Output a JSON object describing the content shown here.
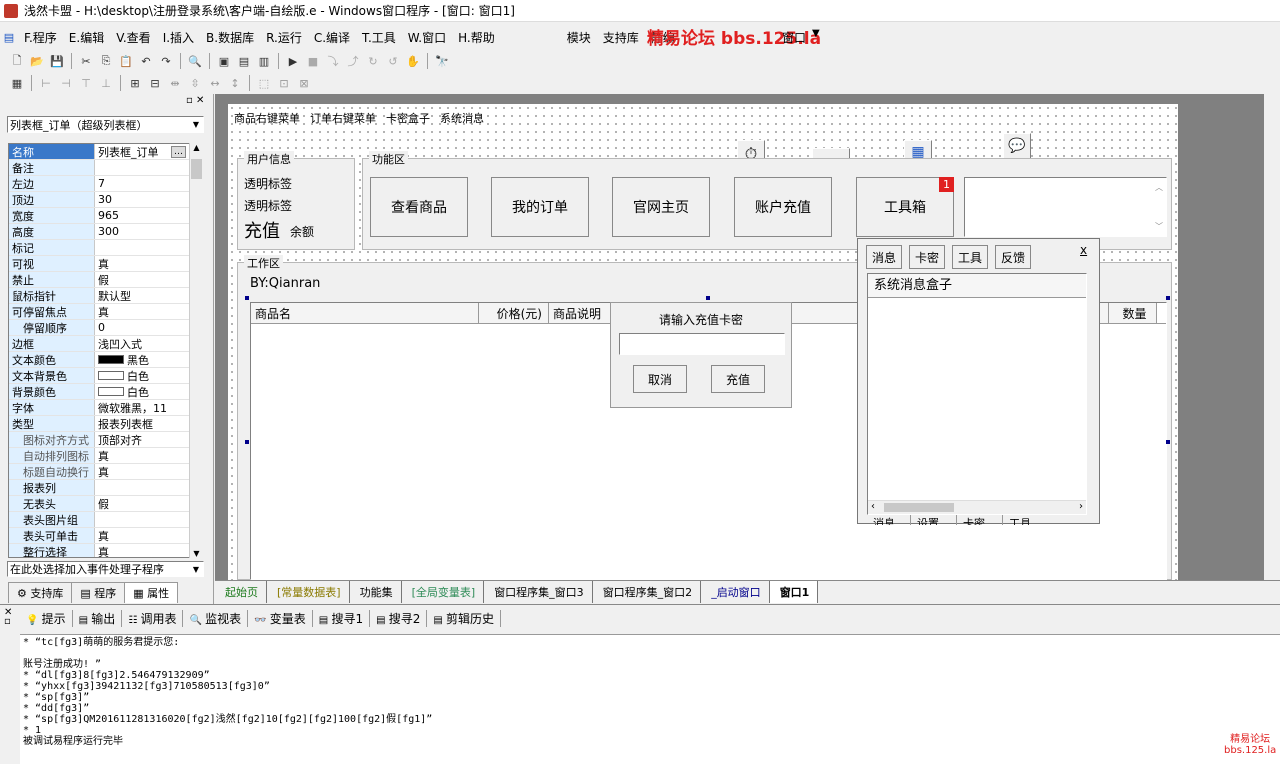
{
  "window": {
    "title": "浅然卡盟 - H:\\desktop\\注册登录系统\\客户端-自绘版.e - Windows窗口程序 - [窗口: 窗口1]"
  },
  "watermark": {
    "text": "精易论坛 bbs.125.la",
    "corner_line1": "精易论坛",
    "corner_line2": "bbs.125.la"
  },
  "menu": {
    "items": [
      "F.程序",
      "E.编辑",
      "V.查看",
      "I.插入",
      "B.数据库",
      "R.运行",
      "C.编译",
      "T.工具",
      "W.窗口",
      "H.帮助"
    ],
    "right_items": [
      "模块",
      "支持库",
      "静编",
      "",
      "",
      "",
      "",
      "窗口"
    ]
  },
  "left_panel": {
    "combo": "列表框_订单（超级列表框）",
    "props": [
      {
        "name": "名称",
        "value": "列表框_订单",
        "style": "blue"
      },
      {
        "name": "备注",
        "value": ""
      },
      {
        "name": "左边",
        "value": "7"
      },
      {
        "name": "顶边",
        "value": "30"
      },
      {
        "name": "宽度",
        "value": "965"
      },
      {
        "name": "高度",
        "value": "300"
      },
      {
        "name": "标记",
        "value": ""
      },
      {
        "name": "可视",
        "value": "真"
      },
      {
        "name": "禁止",
        "value": "假"
      },
      {
        "name": "鼠标指针",
        "value": "默认型"
      },
      {
        "name": "可停留焦点",
        "value": "真"
      },
      {
        "name": "停留顺序",
        "value": "0",
        "indent": true
      },
      {
        "name": "边框",
        "value": "浅凹入式"
      },
      {
        "name": "文本颜色",
        "value": "黑色",
        "swatch": "#000000"
      },
      {
        "name": "文本背景色",
        "value": "白色",
        "swatch": "#ffffff"
      },
      {
        "name": "背景颜色",
        "value": "白色",
        "swatch": "#ffffff"
      },
      {
        "name": "字体",
        "value": "微软雅黑，11"
      },
      {
        "name": "类型",
        "value": "报表列表框"
      },
      {
        "name": "图标对齐方式",
        "value": "顶部对齐",
        "indent": true,
        "gray": true
      },
      {
        "name": "自动排列图标",
        "value": "真",
        "indent": true,
        "gray": true
      },
      {
        "name": "标题自动换行",
        "value": "真",
        "indent": true,
        "gray": true
      },
      {
        "name": "报表列",
        "value": "",
        "indent": true
      },
      {
        "name": "无表头",
        "value": "假",
        "indent": true
      },
      {
        "name": "表头图片组",
        "value": "",
        "indent": true
      },
      {
        "name": "表头可单击",
        "value": "真",
        "indent": true
      },
      {
        "name": "整行选择",
        "value": "真",
        "indent": true
      }
    ],
    "event_combo": "在此处选择加入事件处理子程序",
    "bottom_tabs": [
      "支持库",
      "程序",
      "属性"
    ]
  },
  "designer": {
    "menu": [
      "商品右键菜单",
      "订单右键菜单",
      "卡密盒子",
      "系统消息"
    ],
    "user_group": {
      "title": "用户信息",
      "label1": "透明标签",
      "label2": "透明标签",
      "recharge": "充值",
      "balance": "余额"
    },
    "func_group": {
      "title": "功能区",
      "buttons": [
        "查看商品",
        "我的订单",
        "官网主页",
        "账户充值",
        "工具箱"
      ],
      "badge": "1"
    },
    "work_group": {
      "title": "工作区",
      "by": "BY:Qianran"
    },
    "table_headers": [
      "商品名",
      "价格(元)",
      "商品说明",
      "数量"
    ],
    "dialog": {
      "title": "请输入充值卡密",
      "cancel": "取消",
      "confirm": "充值"
    },
    "msgbox": {
      "buttons": [
        "消息",
        "卡密",
        "工具",
        "反馈"
      ],
      "close": "x",
      "header": "系统消息盒子",
      "tabs": [
        "消息",
        "设置",
        "卡密",
        "工具"
      ]
    }
  },
  "editor_tabs": [
    "起始页",
    "[常量数据表]",
    "功能集",
    "[全局变量表]",
    "窗口程序集_窗口3",
    "窗口程序集_窗口2",
    "_启动窗口",
    "窗口1"
  ],
  "bottom_tabs": [
    "提示",
    "输出",
    "调用表",
    "监视表",
    "变量表",
    "搜寻1",
    "搜寻2",
    "剪辑历史"
  ],
  "output_lines": [
    "* “tc[fg3]萌萌的服务君提示您:",
    "",
    "账号注册成功! ”",
    "* “dl[fg3]8[fg3]2.546479132909”",
    "* “yhxx[fg3]39421132[fg3]710580513[fg3]0”",
    "* “sp[fg3]”",
    "* “dd[fg3]”",
    "* “sp[fg3]QM201611281316020[fg2]浅然[fg2]10[fg2][fg2]100[fg2]假[fg1]”",
    "* 1",
    "被调试易程序运行完毕"
  ]
}
